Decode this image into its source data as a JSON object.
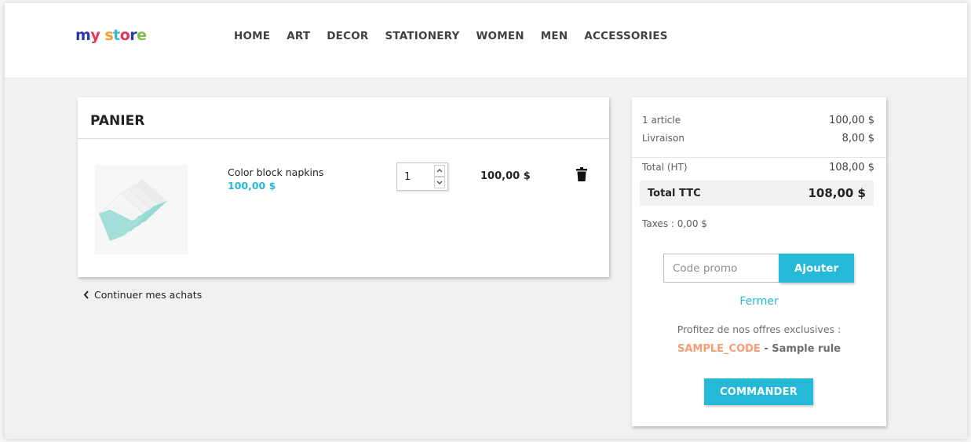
{
  "header": {
    "logo_text": "my store",
    "nav": [
      "HOME",
      "ART",
      "DECOR",
      "STATIONERY",
      "WOMEN",
      "MEN",
      "ACCESSORIES"
    ]
  },
  "cart": {
    "title": "PANIER",
    "items": [
      {
        "name": "Color block napkins",
        "unit_price": "100,00 $",
        "quantity": "1",
        "line_total": "100,00 $"
      }
    ],
    "continue_label": "Continuer mes achats"
  },
  "summary": {
    "articles_label": "1 article",
    "articles_value": "100,00 $",
    "shipping_label": "Livraison",
    "shipping_value": "8,00 $",
    "total_ht_label": "Total (HT)",
    "total_ht_value": "108,00 $",
    "total_ttc_label": "Total TTC",
    "total_ttc_value": "108,00 $",
    "taxes": "Taxes : 0,00 $",
    "promo_placeholder": "Code promo",
    "promo_button": "Ajouter",
    "close_label": "Fermer",
    "offers_label": "Profitez de nos offres exclusives :",
    "voucher_code": "SAMPLE_CODE",
    "voucher_separator": " - ",
    "voucher_name": "Sample rule",
    "checkout_label": "COMMANDER"
  },
  "colors": {
    "accent": "#24b9d7",
    "voucher": "#f39d72",
    "background": "#f1f1f1"
  },
  "icons": [
    "trash-icon",
    "chevron-left-icon",
    "spinner-up-icon",
    "spinner-down-icon",
    "napkins-product-image"
  ]
}
